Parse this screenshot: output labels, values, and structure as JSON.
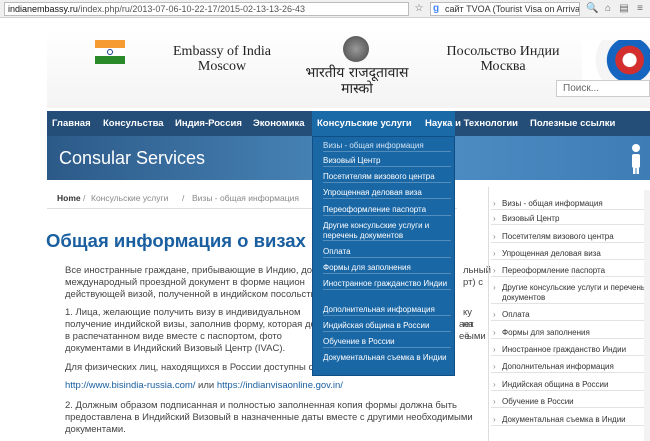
{
  "browser": {
    "url_host": "indianembassy.ru",
    "url_path": "/index.php/ru/2013-07-06-10-22-17/2015-02-13-13-26-43",
    "search_text": "сайт TVOA (Tourist Visa on Arrival)"
  },
  "header": {
    "title_en_line1": "Embassy of India",
    "title_en_line2": "Moscow",
    "title_hi_line1": "भारतीय राजदूतावास",
    "title_hi_line2": "मास्को",
    "title_ru_line1": "Посольство Индии",
    "title_ru_line2": "Москва",
    "search_placeholder": "Поиск..."
  },
  "nav": {
    "items": [
      {
        "label": "Главная"
      },
      {
        "label": "Консульства"
      },
      {
        "label": "Индия-Россия"
      },
      {
        "label": "Экономика"
      },
      {
        "label": "Консульские услуги"
      },
      {
        "label": "Наука и Технологии"
      },
      {
        "label": "Полезные ссылки"
      }
    ]
  },
  "banner": {
    "title": "Consular Services"
  },
  "breadcrumb": {
    "home": "Home",
    "item1": "Консульские услуги",
    "item2": "Визы - общая информация"
  },
  "main": {
    "title": "Общая информация о визах",
    "p1_l1": "Все иностранные граждане, прибывающие в Индию, до",
    "p1_l1_end": "льный",
    "p1_l2": "международный проездной документ в форме национ",
    "p1_l2_end": "рт) с",
    "p1_l3": "действующей визой, полученной в индийском посольств",
    "p2_l1": "1. Лица, желающие получить визу в индивидуальном",
    "p2_l1_end": "ку на",
    "p2_l2": "получение индийской визы, заполнив форму, которая дос",
    "p2_l2_end": "ает её",
    "p2_l3": "в распечатанном виде вместе с паспортом, фото",
    "p2_l3_end": "ыми",
    "p2_l4": "документами в Индийский Визовый Центр (IVAC).",
    "p3": "Для физических лиц, находящихся в России доступны сле",
    "link1": "http://www.bisindia-russia.com/",
    "link_sep": " или ",
    "link2": "https://indianvisaonline.gov.in/",
    "p4_l1": "2. Должным образом подписанная и полностью заполненная копия формы должна быть",
    "p4_l2": "предоставлена в Индийский Визовый в назначенные даты вместе с другими необходимыми",
    "p4_l3": "документами."
  },
  "dropdown": {
    "items": [
      "Визы - общая информация",
      "Визовый Центр",
      "Посетителям визового центра",
      "Упрощенная деловая виза",
      "Переоформление паспорта",
      "Другие консульские услуги и перечень документов",
      "Оплата",
      "Формы для заполнения",
      "Иностранное гражданство Индии",
      "Дополнительная информация",
      "Индийская община в России",
      "Обучение в России",
      "Документальная съемка в Индии"
    ]
  },
  "rightnav": {
    "items": [
      "Визы - общая информация",
      "Визовый Центр",
      "Посетителям визового центра",
      "Упрощенная деловая виза",
      "Переоформление паспорта",
      "Другие консульские услуги и перечень документов",
      "Оплата",
      "Формы для заполнения",
      "Иностранное гражданство Индии",
      "Дополнительная информация",
      "Индийская община в России",
      "Обучение в России",
      "Документальная съемка в Индии"
    ]
  },
  "colors": {
    "nav_bg": "#244d78",
    "nav_active": "#1b6aa8",
    "title_blue": "#1a5fa0",
    "dropdown_bg": "#1a67a6"
  }
}
